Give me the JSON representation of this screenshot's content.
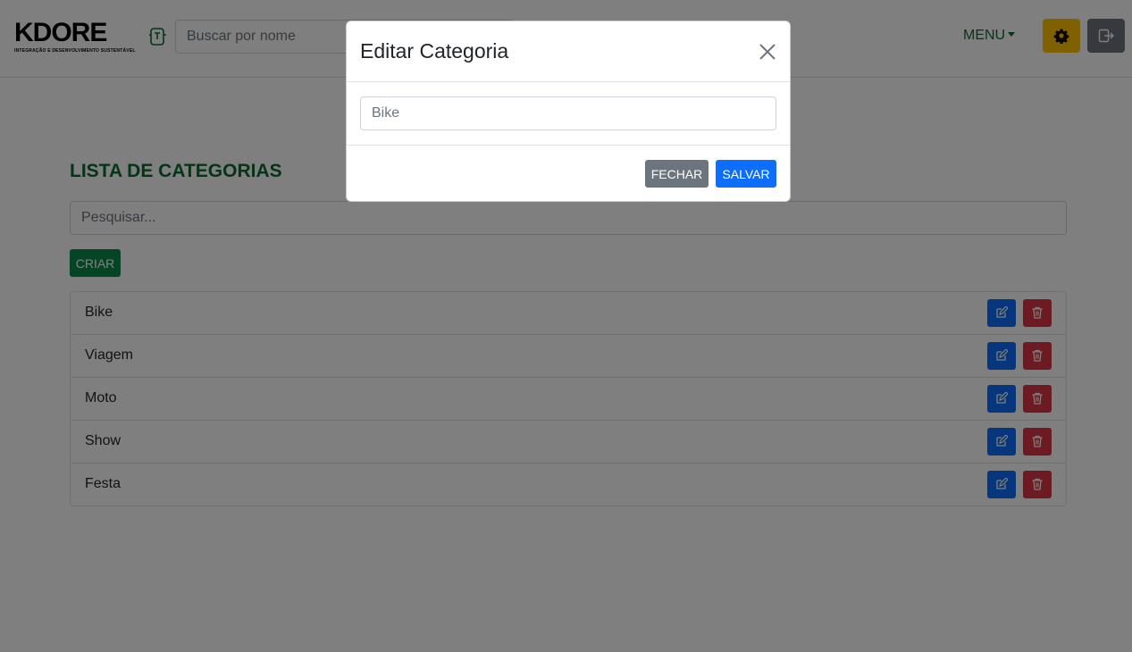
{
  "navbar": {
    "logo_text": "KDORE",
    "logo_subtitle": "INTEGRAÇÃO E DESENVOLVIMENTO SUSTENTÁVEL",
    "search_placeholder": "Buscar por nome",
    "menu_label": "MENU"
  },
  "main": {
    "title": "LISTA DE CATEGORIAS",
    "filter_placeholder": "Pesquisar...",
    "create_label": "CRIAR",
    "categories": [
      "Bike",
      "Viagem",
      "Moto",
      "Show",
      "Festa"
    ]
  },
  "modal": {
    "title": "Editar Categoria",
    "input_value": "Bike",
    "close_label": "FECHAR",
    "save_label": "SALVAR"
  },
  "colors": {
    "primary": "#0d6efd",
    "danger": "#dc3545",
    "warning": "#ffc107",
    "secondary": "#6c757d",
    "brand_green": "#0b6b2e"
  },
  "icons": {
    "nav": "id-badge-icon",
    "gear": "gear-icon",
    "exit": "logout-icon",
    "edit": "edit-icon",
    "delete": "trash-icon",
    "close": "close-icon"
  }
}
